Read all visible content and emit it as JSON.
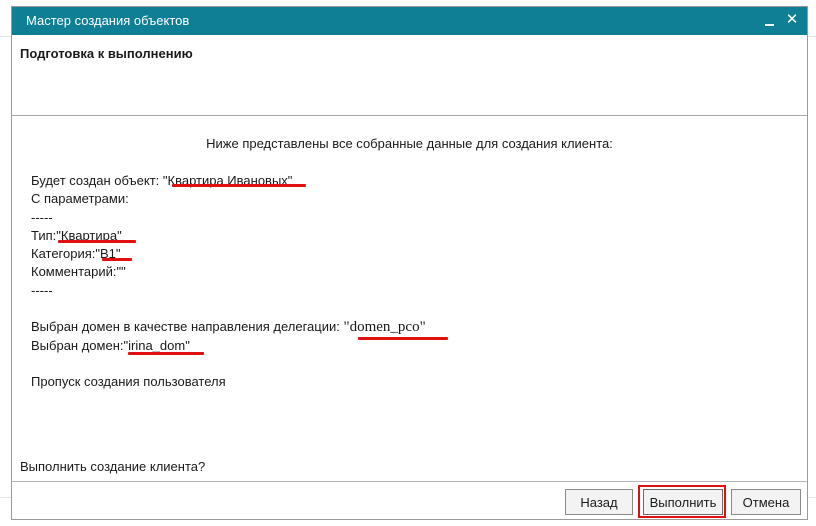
{
  "window": {
    "title": "Мастер создания объектов",
    "minimize_glyph": "_",
    "close_glyph": "✕"
  },
  "header": {
    "title": "Подготовка к выполнению"
  },
  "content": {
    "intro": "Ниже представлены все собранные данные для создания клиента:",
    "object_label": "Будет создан объект: ",
    "object_value": "\"Квартира Ивановых\"",
    "params_label": "С параметрами:",
    "separator": "-----",
    "type_label": "Тип:",
    "type_value": "\"Квартира\"",
    "category_label": "Категория:",
    "category_value": "\"B1\"",
    "comment_label": "Комментарий:",
    "comment_value": "\"\"",
    "delegation_label": "Выбран домен в качестве направления делегации: ",
    "delegation_value": "\"domen_pco\"",
    "domain_label": "Выбран домен:",
    "domain_value": "\"irina_dom\"",
    "skip_user": "Пропуск создания пользователя",
    "question": "Выполнить создание клиента?"
  },
  "buttons": {
    "back": "Назад",
    "run": "Выполнить",
    "cancel": "Отмена"
  },
  "colors": {
    "titlebar": "#0f7f96",
    "highlight": "#e01010"
  }
}
